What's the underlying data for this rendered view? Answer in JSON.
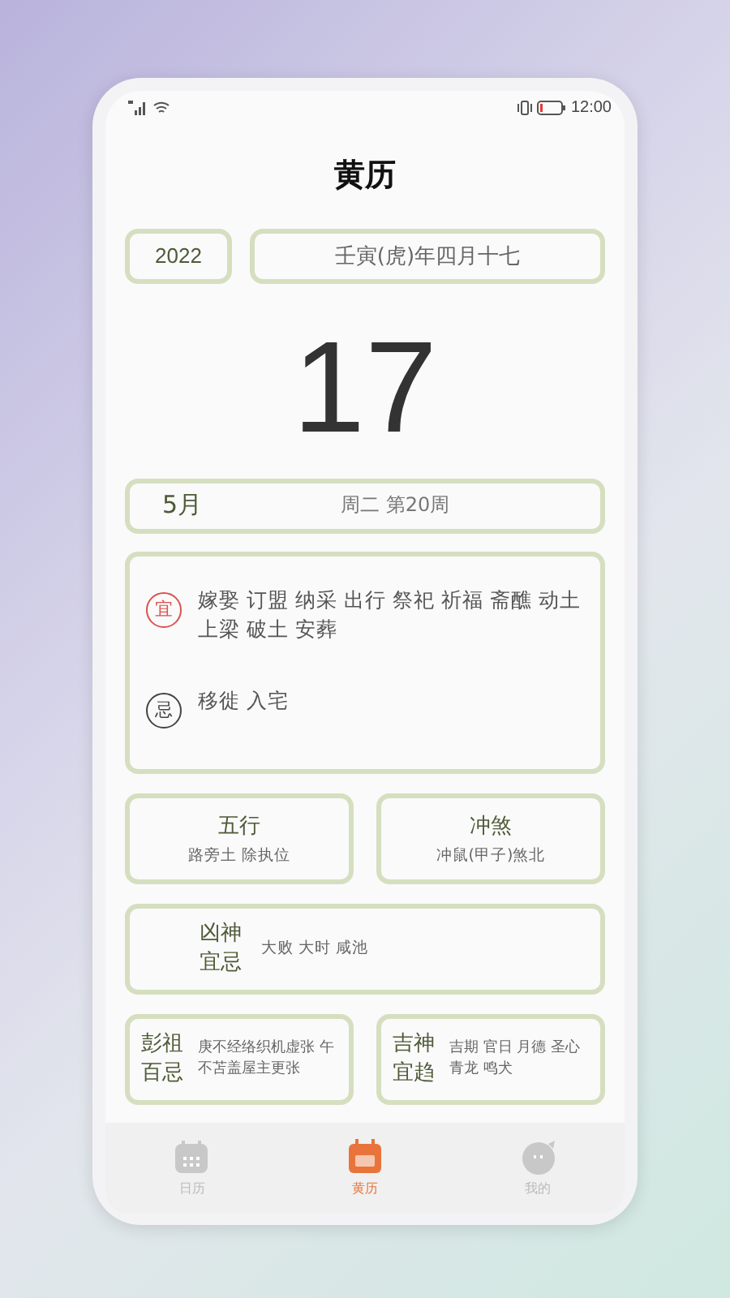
{
  "status_bar": {
    "time": "12:00"
  },
  "title": "黄历",
  "year": "2022",
  "lunar_date": "壬寅(虎)年四月十七",
  "day": "17",
  "month": "5月",
  "week_info": "周二 第20周",
  "activities": [
    {
      "kind": "yi",
      "mark": "宜",
      "lines": [
        "嫁娶 订盟 纳采 出行 祭祀 祈福 斋醮 动土",
        "上梁 破土 安葬"
      ]
    },
    {
      "kind": "ji",
      "mark": "忌",
      "lines": [
        "移徙 入宅"
      ]
    }
  ],
  "info_cards": [
    {
      "kind": "stack",
      "title": "五行",
      "text": "路旁土 除执位"
    },
    {
      "kind": "stack",
      "title": "冲煞",
      "text": "冲鼠(甲子)煞北"
    },
    {
      "kind": "wide",
      "title": "凶神宜忌",
      "text": "大败 大时 咸池"
    },
    {
      "kind": "side",
      "title": "彭祖百忌",
      "lines": [
        "庚不经络织机虚张 午",
        "不苫盖屋主更张"
      ]
    },
    {
      "kind": "side",
      "title": "吉神宜趋",
      "lines": [
        "吉期 官日 月德 圣心",
        "青龙 鸣犬"
      ]
    }
  ],
  "tabs": [
    {
      "label": "日历",
      "kind": "calendar",
      "selected": false
    },
    {
      "label": "黄历",
      "kind": "almanac",
      "selected": true
    },
    {
      "label": "我的",
      "kind": "face",
      "selected": false
    }
  ]
}
